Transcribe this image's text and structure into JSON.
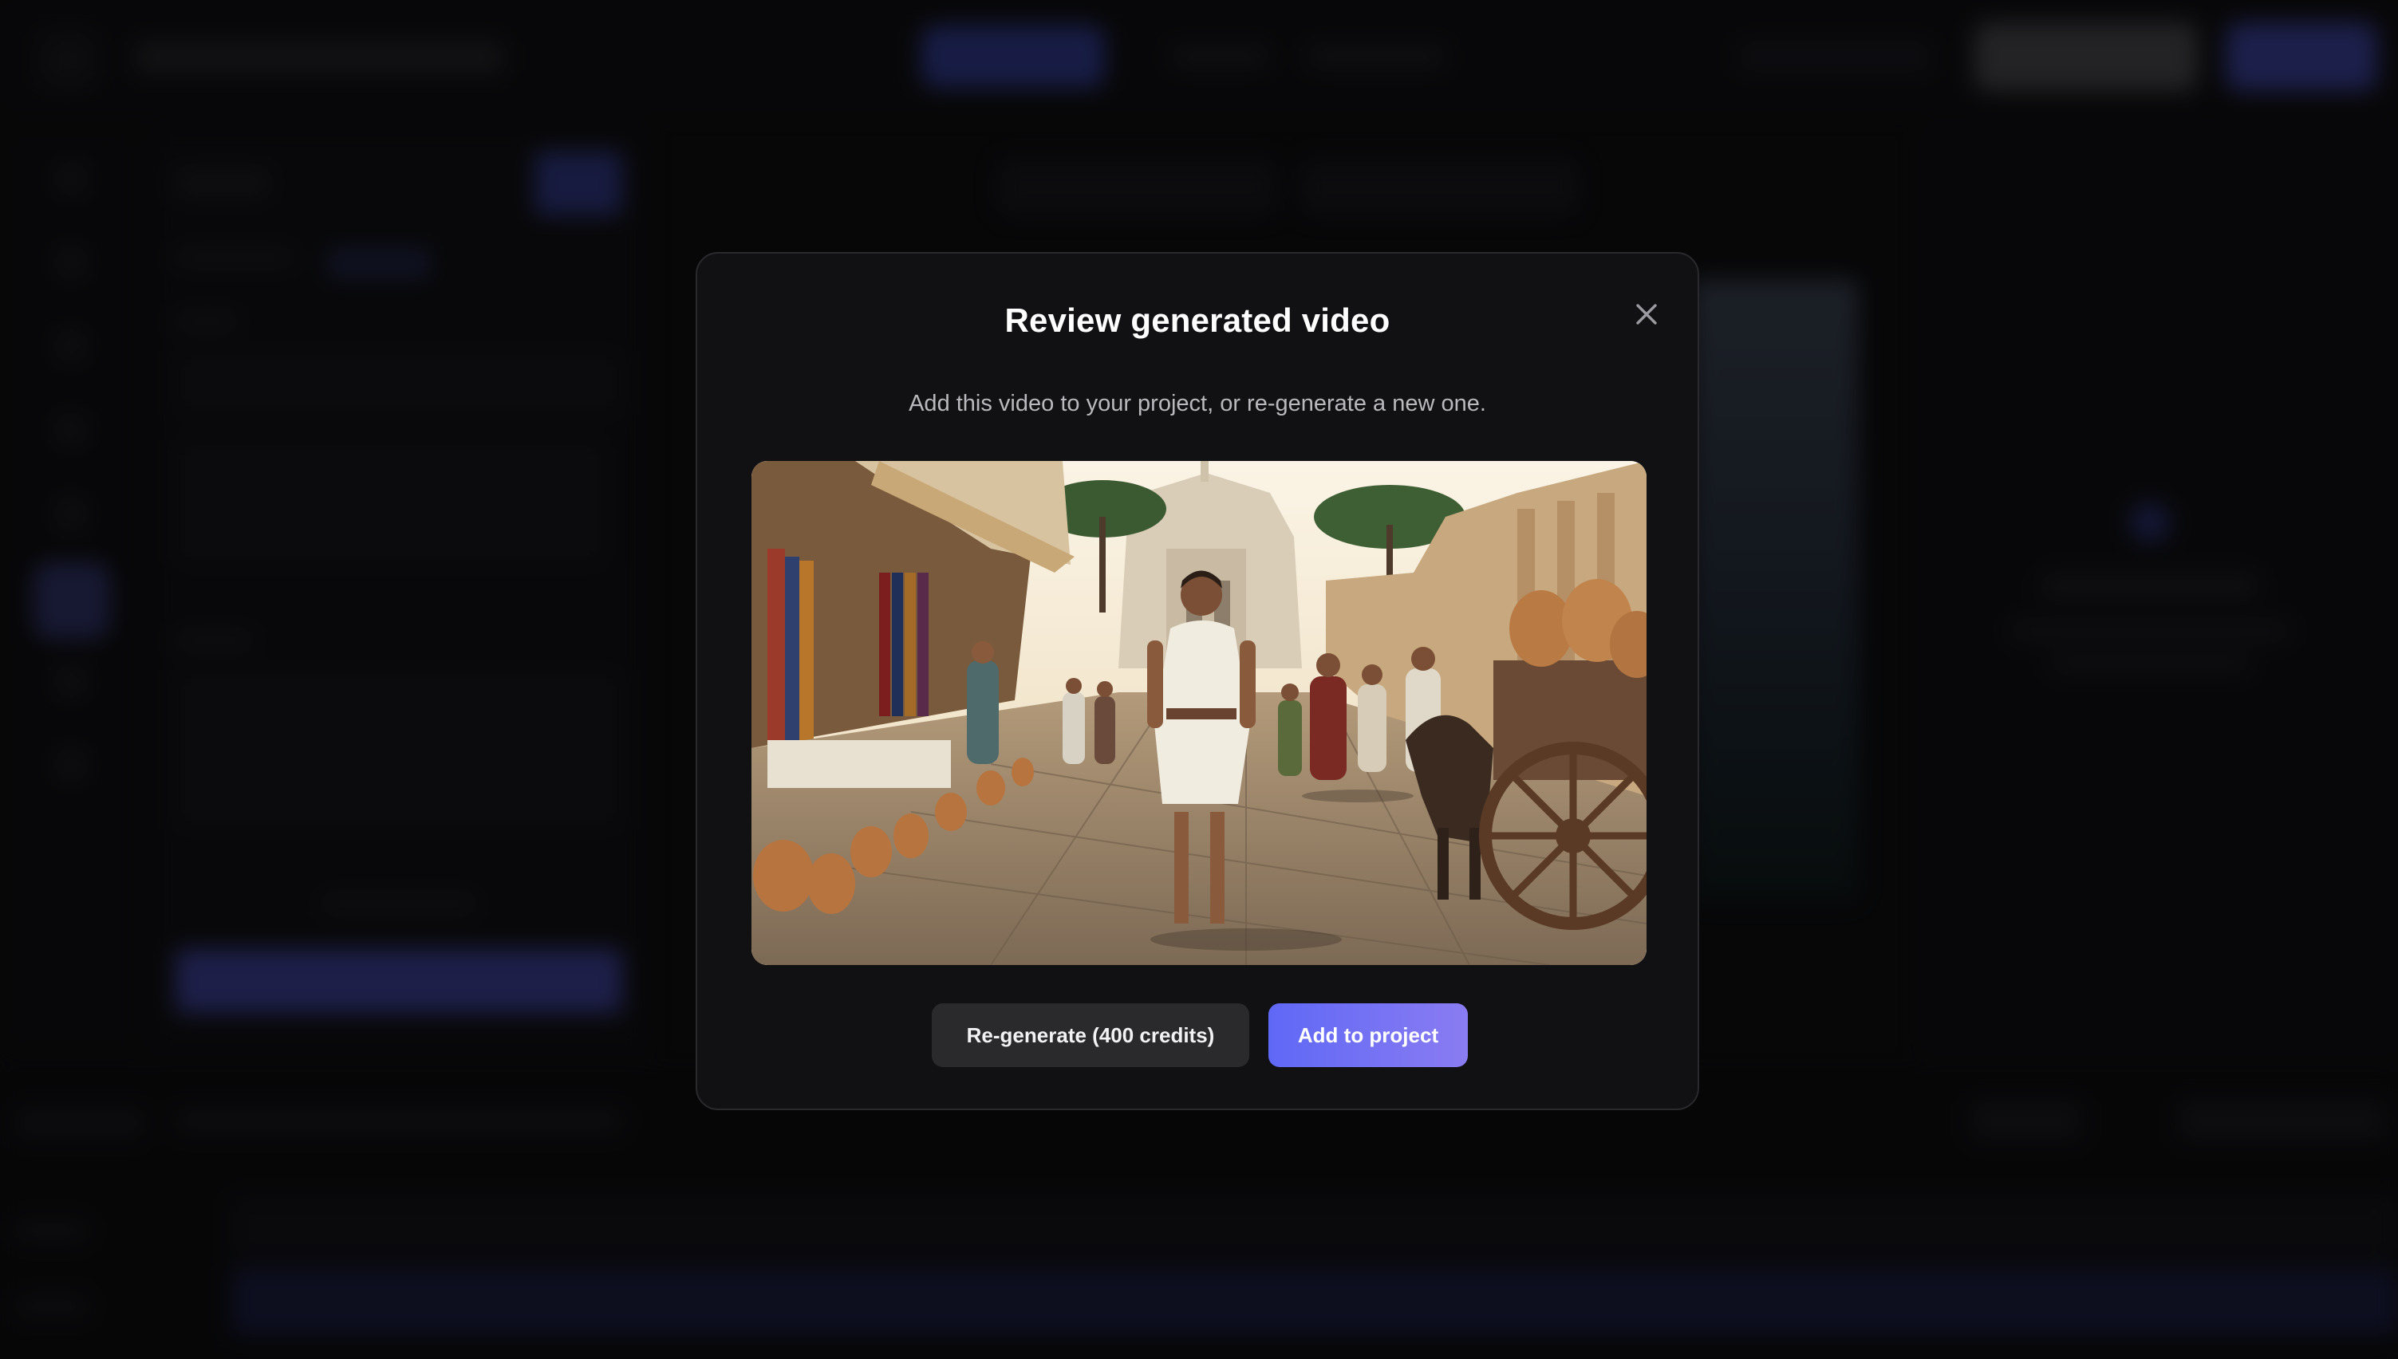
{
  "modal": {
    "title": "Review generated video",
    "subtitle": "Add this video to your project, or re-generate a new one.",
    "close_icon": "close-icon",
    "video_thumbnail": "street-market-scene",
    "regenerate_label": "Re-generate (400 credits)",
    "add_label": "Add to project"
  },
  "colors": {
    "accent_start": "#5f68f6",
    "accent_end": "#8a7cf2",
    "modal_bg": "#111113",
    "secondary_button": "#2a2a2d"
  }
}
